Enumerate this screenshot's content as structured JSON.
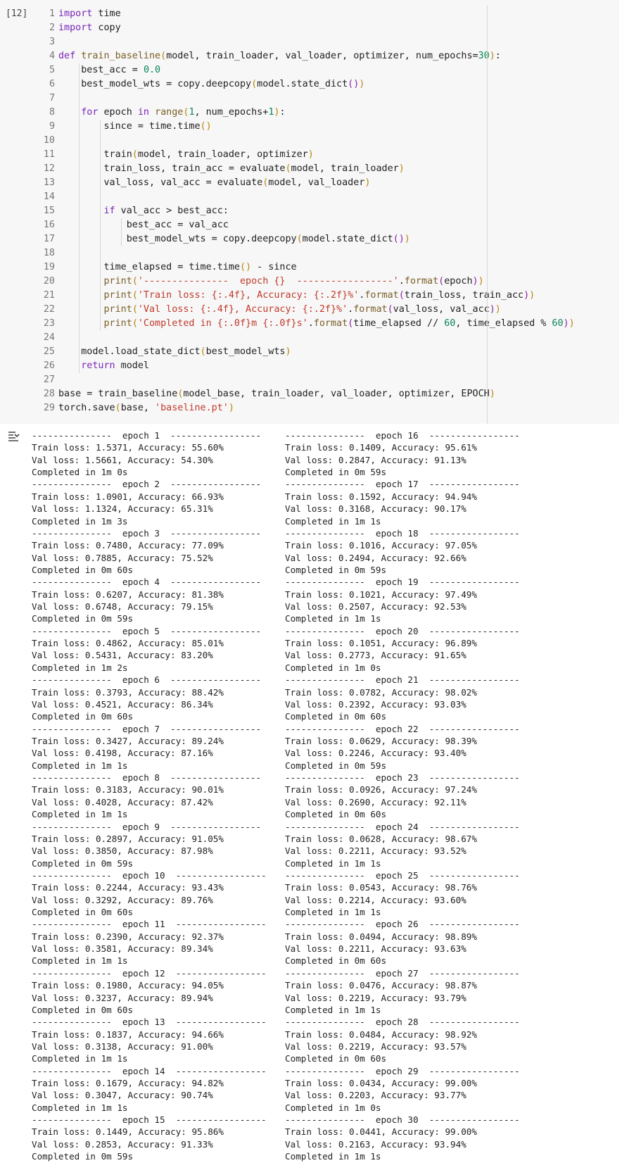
{
  "cell": {
    "execution_count": "[12]",
    "code_lines": [
      {
        "num": "1",
        "html": "<span style=\"color:#7a26b8\">import</span> time"
      },
      {
        "num": "2",
        "html": "<span style=\"color:#7a26b8\">import</span> copy"
      },
      {
        "num": "3",
        "html": ""
      },
      {
        "num": "4",
        "html": "<span style=\"color:#7a26b8\">def</span> <span style=\"color:#795e26\">train_baseline</span><span style=\"color:#b8860b\">(</span>model, train_loader, val_loader, optimizer, num_epochs=<span style=\"color:#098658\">30</span><span style=\"color:#b8860b\">)</span>:"
      },
      {
        "num": "5",
        "html": "    best_acc = <span style=\"color:#098658\">0.0</span>"
      },
      {
        "num": "6",
        "html": "    best_model_wts = copy.deepcopy<span style=\"color:#b8860b\">(</span>model.state_dict<span style=\"color:#8b1fa9\">()</span><span style=\"color:#b8860b\">)</span>"
      },
      {
        "num": "7",
        "html": ""
      },
      {
        "num": "8",
        "html": "    <span style=\"color:#7a26b8\">for</span> epoch <span style=\"color:#7a26b8\">in</span> <span style=\"color:#795e26\">range</span><span style=\"color:#b8860b\">(</span><span style=\"color:#098658\">1</span>, num_epochs+<span style=\"color:#098658\">1</span><span style=\"color:#b8860b\">)</span>:"
      },
      {
        "num": "9",
        "html": "        since = time.time<span style=\"color:#b8860b\">()</span>"
      },
      {
        "num": "10",
        "html": ""
      },
      {
        "num": "11",
        "html": "        train<span style=\"color:#b8860b\">(</span>model, train_loader, optimizer<span style=\"color:#b8860b\">)</span>"
      },
      {
        "num": "12",
        "html": "        train_loss, train_acc = evaluate<span style=\"color:#b8860b\">(</span>model, train_loader<span style=\"color:#b8860b\">)</span>"
      },
      {
        "num": "13",
        "html": "        val_loss, val_acc = evaluate<span style=\"color:#b8860b\">(</span>model, val_loader<span style=\"color:#b8860b\">)</span>"
      },
      {
        "num": "14",
        "html": ""
      },
      {
        "num": "15",
        "html": "        <span style=\"color:#7a26b8\">if</span> val_acc &gt; best_acc:"
      },
      {
        "num": "16",
        "html": "            best_acc = val_acc"
      },
      {
        "num": "17",
        "html": "            best_model_wts = copy.deepcopy<span style=\"color:#b8860b\">(</span>model.state_dict<span style=\"color:#8b1fa9\">()</span><span style=\"color:#b8860b\">)</span>"
      },
      {
        "num": "18",
        "html": ""
      },
      {
        "num": "19",
        "html": "        time_elapsed = time.time<span style=\"color:#b8860b\">()</span> - since"
      },
      {
        "num": "20",
        "html": "        <span style=\"color:#795e26\">print</span><span style=\"color:#b8860b\">(</span><span style=\"color:#c0392b\">'---------------  epoch {}  -----------------'</span>.<span style=\"color:#795e26\">format</span><span style=\"color:#8b1fa9\">(</span>epoch<span style=\"color:#8b1fa9\">)</span><span style=\"color:#b8860b\">)</span>"
      },
      {
        "num": "21",
        "html": "        <span style=\"color:#795e26\">print</span><span style=\"color:#b8860b\">(</span><span style=\"color:#c0392b\">'Train loss: {:.4f}, Accuracy: {:.2f}%'</span>.<span style=\"color:#795e26\">format</span><span style=\"color:#8b1fa9\">(</span>train_loss, train_acc<span style=\"color:#8b1fa9\">)</span><span style=\"color:#b8860b\">)</span>"
      },
      {
        "num": "22",
        "html": "        <span style=\"color:#795e26\">print</span><span style=\"color:#b8860b\">(</span><span style=\"color:#c0392b\">'Val loss: {:.4f}, Accuracy: {:.2f}%'</span>.<span style=\"color:#795e26\">format</span><span style=\"color:#8b1fa9\">(</span>val_loss, val_acc<span style=\"color:#8b1fa9\">)</span><span style=\"color:#b8860b\">)</span>"
      },
      {
        "num": "23",
        "html": "        <span style=\"color:#795e26\">print</span><span style=\"color:#b8860b\">(</span><span style=\"color:#c0392b\">'Completed in {:.0f}m {:.0f}s'</span>.<span style=\"color:#795e26\">format</span><span style=\"color:#8b1fa9\">(</span>time_elapsed // <span style=\"color:#098658\">60</span>, time_elapsed % <span style=\"color:#098658\">60</span><span style=\"color:#8b1fa9\">)</span><span style=\"color:#b8860b\">)</span>"
      },
      {
        "num": "24",
        "html": ""
      },
      {
        "num": "25",
        "html": "    model.load_state_dict<span style=\"color:#b8860b\">(</span>best_model_wts<span style=\"color:#b8860b\">)</span>"
      },
      {
        "num": "26",
        "html": "    <span style=\"color:#7a26b8\">return</span> model"
      },
      {
        "num": "27",
        "html": ""
      },
      {
        "num": "28",
        "html": "base = train_baseline<span style=\"color:#b8860b\">(</span>model_base, train_loader, val_loader, optimizer, EPOCH<span style=\"color:#b8860b\">)</span>"
      },
      {
        "num": "29",
        "html": "torch.save<span style=\"color:#b8860b\">(</span>base, <span style=\"color:#c0392b\">'baseline.pt'</span><span style=\"color:#b8860b\">)</span>"
      }
    ]
  },
  "output": {
    "toggle_icon": "output-toggle-icon",
    "epochs": [
      {
        "epoch": "1",
        "train_loss": "1.5371",
        "train_acc": "55.60",
        "val_loss": "1.5661",
        "val_acc": "54.30",
        "time": "1m 0s"
      },
      {
        "epoch": "2",
        "train_loss": "1.0901",
        "train_acc": "66.93",
        "val_loss": "1.1324",
        "val_acc": "65.31",
        "time": "1m 3s"
      },
      {
        "epoch": "3",
        "train_loss": "0.7480",
        "train_acc": "77.09",
        "val_loss": "0.7885",
        "val_acc": "75.52",
        "time": "0m 60s"
      },
      {
        "epoch": "4",
        "train_loss": "0.6207",
        "train_acc": "81.38",
        "val_loss": "0.6748",
        "val_acc": "79.15",
        "time": "0m 59s"
      },
      {
        "epoch": "5",
        "train_loss": "0.4862",
        "train_acc": "85.01",
        "val_loss": "0.5431",
        "val_acc": "83.20",
        "time": "1m 2s"
      },
      {
        "epoch": "6",
        "train_loss": "0.3793",
        "train_acc": "88.42",
        "val_loss": "0.4521",
        "val_acc": "86.34",
        "time": "0m 60s"
      },
      {
        "epoch": "7",
        "train_loss": "0.3427",
        "train_acc": "89.24",
        "val_loss": "0.4198",
        "val_acc": "87.16",
        "time": "1m 1s"
      },
      {
        "epoch": "8",
        "train_loss": "0.3183",
        "train_acc": "90.01",
        "val_loss": "0.4028",
        "val_acc": "87.42",
        "time": "1m 1s"
      },
      {
        "epoch": "9",
        "train_loss": "0.2897",
        "train_acc": "91.05",
        "val_loss": "0.3850",
        "val_acc": "87.98",
        "time": "0m 59s"
      },
      {
        "epoch": "10",
        "train_loss": "0.2244",
        "train_acc": "93.43",
        "val_loss": "0.3292",
        "val_acc": "89.76",
        "time": "0m 60s"
      },
      {
        "epoch": "11",
        "train_loss": "0.2390",
        "train_acc": "92.37",
        "val_loss": "0.3581",
        "val_acc": "89.34",
        "time": "1m 1s"
      },
      {
        "epoch": "12",
        "train_loss": "0.1980",
        "train_acc": "94.05",
        "val_loss": "0.3237",
        "val_acc": "89.94",
        "time": "0m 60s"
      },
      {
        "epoch": "13",
        "train_loss": "0.1837",
        "train_acc": "94.66",
        "val_loss": "0.3138",
        "val_acc": "91.00",
        "time": "1m 1s"
      },
      {
        "epoch": "14",
        "train_loss": "0.1679",
        "train_acc": "94.82",
        "val_loss": "0.3047",
        "val_acc": "90.74",
        "time": "1m 1s"
      },
      {
        "epoch": "15",
        "train_loss": "0.1449",
        "train_acc": "95.86",
        "val_loss": "0.2853",
        "val_acc": "91.33",
        "time": "0m 59s"
      },
      {
        "epoch": "16",
        "train_loss": "0.1409",
        "train_acc": "95.61",
        "val_loss": "0.2847",
        "val_acc": "91.13",
        "time": "0m 59s"
      },
      {
        "epoch": "17",
        "train_loss": "0.1592",
        "train_acc": "94.94",
        "val_loss": "0.3168",
        "val_acc": "90.17",
        "time": "1m 1s"
      },
      {
        "epoch": "18",
        "train_loss": "0.1016",
        "train_acc": "97.05",
        "val_loss": "0.2494",
        "val_acc": "92.66",
        "time": "0m 59s"
      },
      {
        "epoch": "19",
        "train_loss": "0.1021",
        "train_acc": "97.49",
        "val_loss": "0.2507",
        "val_acc": "92.53",
        "time": "1m 1s"
      },
      {
        "epoch": "20",
        "train_loss": "0.1051",
        "train_acc": "96.89",
        "val_loss": "0.2773",
        "val_acc": "91.65",
        "time": "1m 0s"
      },
      {
        "epoch": "21",
        "train_loss": "0.0782",
        "train_acc": "98.02",
        "val_loss": "0.2392",
        "val_acc": "93.03",
        "time": "0m 60s"
      },
      {
        "epoch": "22",
        "train_loss": "0.0629",
        "train_acc": "98.39",
        "val_loss": "0.2246",
        "val_acc": "93.40",
        "time": "0m 59s"
      },
      {
        "epoch": "23",
        "train_loss": "0.0926",
        "train_acc": "97.24",
        "val_loss": "0.2690",
        "val_acc": "92.11",
        "time": "0m 60s"
      },
      {
        "epoch": "24",
        "train_loss": "0.0628",
        "train_acc": "98.67",
        "val_loss": "0.2211",
        "val_acc": "93.52",
        "time": "1m 1s"
      },
      {
        "epoch": "25",
        "train_loss": "0.0543",
        "train_acc": "98.76",
        "val_loss": "0.2214",
        "val_acc": "93.60",
        "time": "1m 1s"
      },
      {
        "epoch": "26",
        "train_loss": "0.0494",
        "train_acc": "98.89",
        "val_loss": "0.2211",
        "val_acc": "93.63",
        "time": "0m 60s"
      },
      {
        "epoch": "27",
        "train_loss": "0.0476",
        "train_acc": "98.87",
        "val_loss": "0.2219",
        "val_acc": "93.79",
        "time": "1m 1s"
      },
      {
        "epoch": "28",
        "train_loss": "0.0484",
        "train_acc": "98.92",
        "val_loss": "0.2219",
        "val_acc": "93.57",
        "time": "0m 60s"
      },
      {
        "epoch": "29",
        "train_loss": "0.0434",
        "train_acc": "99.00",
        "val_loss": "0.2203",
        "val_acc": "93.77",
        "time": "1m 0s"
      },
      {
        "epoch": "30",
        "train_loss": "0.0441",
        "train_acc": "99.00",
        "val_loss": "0.2163",
        "val_acc": "93.94",
        "time": "1m 1s"
      }
    ]
  }
}
